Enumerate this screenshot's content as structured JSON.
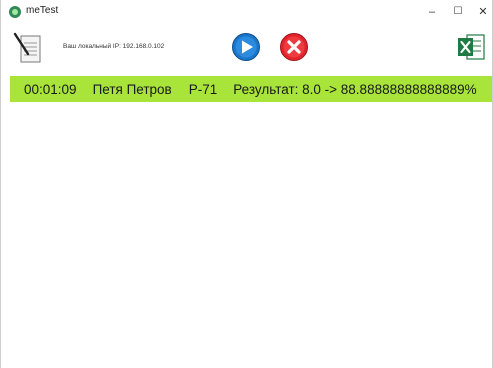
{
  "window": {
    "title": "meTest",
    "minimize": "–",
    "maximize": "☐",
    "close": "✕"
  },
  "toolbar": {
    "ip_label": "Ваш локальный IP: 192.168.0.102"
  },
  "icons": {
    "document": "notepad-icon",
    "play": "play-icon",
    "stop": "stop-icon",
    "excel": "excel-icon"
  },
  "colors": {
    "row_highlight": "#a8e43a",
    "play_blue": "#1b75c9",
    "stop_red": "#e2232b",
    "excel_green": "#1f7a44"
  },
  "results": [
    {
      "time": "00:01:09",
      "name": "Петя Петров",
      "room": "Р-71",
      "result": "Результат: 8.0 -> 88.88888888888889%"
    }
  ]
}
